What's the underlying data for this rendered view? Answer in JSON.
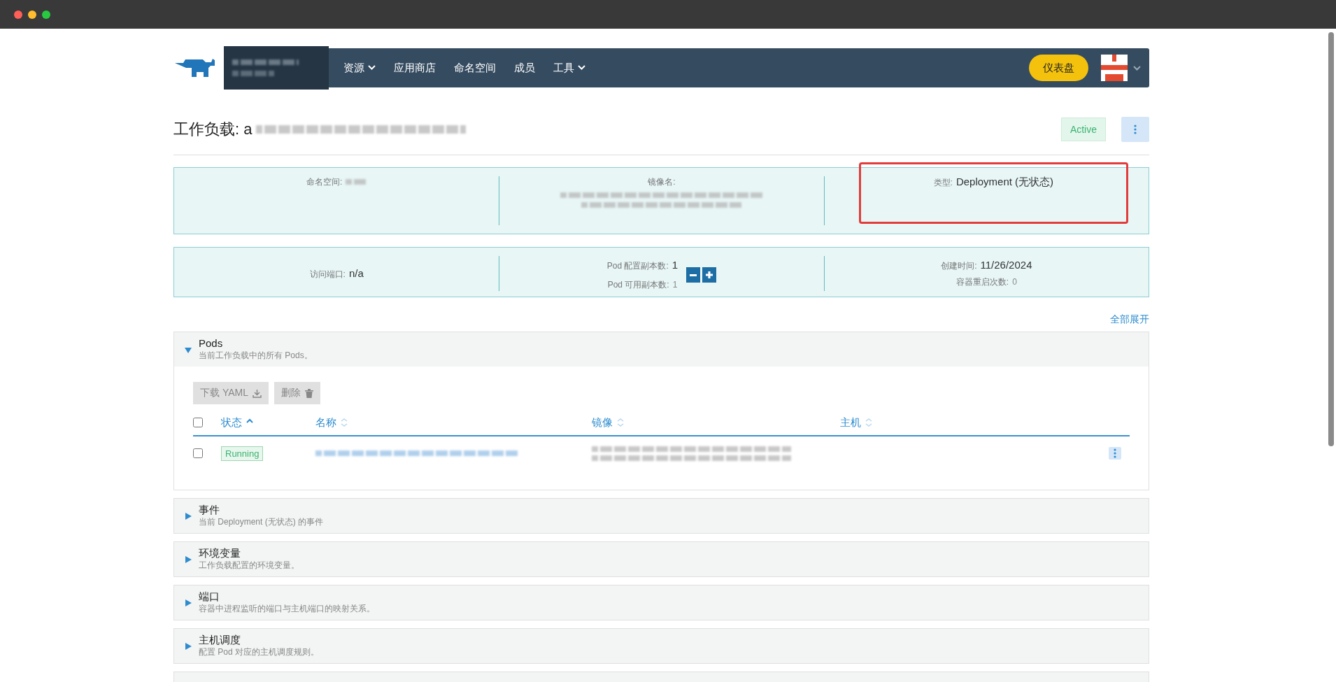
{
  "nav": {
    "items": [
      {
        "label": "资源",
        "dropdown": true
      },
      {
        "label": "应用商店",
        "dropdown": false
      },
      {
        "label": "命名空间",
        "dropdown": false
      },
      {
        "label": "成员",
        "dropdown": false
      },
      {
        "label": "工具",
        "dropdown": true
      }
    ],
    "dashboard_button": "仪表盘"
  },
  "header": {
    "title": "工作负载: a",
    "status": "Active"
  },
  "info_cards": [
    {
      "cells": [
        {
          "kind": "text",
          "highlighted": false,
          "lines": [
            {
              "label": "命名空间:",
              "kind": "redacted"
            }
          ]
        },
        {
          "kind": "text",
          "highlighted": false,
          "lines": [
            {
              "label": "镜像名:",
              "kind": "redacted-block"
            }
          ]
        },
        {
          "kind": "text",
          "highlighted": true,
          "lines": [
            {
              "label": "类型:",
              "value": "Deployment (无状态)",
              "kind": "text"
            }
          ]
        }
      ]
    },
    {
      "cells": [
        {
          "kind": "text",
          "highlighted": false,
          "lines": [
            {
              "label": "访问端口:",
              "value": "n/a",
              "kind": "text"
            }
          ]
        },
        {
          "kind": "scale",
          "highlighted": false,
          "lines": [
            {
              "label": "Pod 配置副本数:",
              "value": "1",
              "kind": "text"
            },
            {
              "label": "Pod 可用副本数:",
              "value": "1",
              "kind": "small"
            }
          ]
        },
        {
          "kind": "text",
          "highlighted": false,
          "lines": [
            {
              "label": "创建时间:",
              "value": "11/26/2024",
              "kind": "text"
            },
            {
              "label": "容器重启次数:",
              "value": "0",
              "kind": "small"
            }
          ]
        }
      ]
    }
  ],
  "expand_all": "全部展开",
  "sections": [
    {
      "title": "Pods",
      "subtitle": "当前工作负载中的所有 Pods。",
      "expanded": true,
      "toolbar": [
        {
          "label": "下载 YAML",
          "kind": "download"
        },
        {
          "label": "删除",
          "kind": "delete"
        }
      ],
      "select_all_checked": false,
      "columns": [
        {
          "label": "状态",
          "sorted": true
        },
        {
          "label": "名称",
          "sorted": false
        },
        {
          "label": "镜像",
          "sorted": false
        },
        {
          "label": "主机",
          "sorted": false
        }
      ],
      "rows": [
        {
          "checked": false,
          "status": "Running"
        }
      ]
    },
    {
      "title": "事件",
      "subtitle": "当前 Deployment (无状态) 的事件",
      "expanded": false
    },
    {
      "title": "环境变量",
      "subtitle": "工作负载配置的环境变量。",
      "expanded": false
    },
    {
      "title": "端口",
      "subtitle": "容器中进程监听的端口与主机端口的映射关系。",
      "expanded": false
    },
    {
      "title": "主机调度",
      "subtitle": "配置 Pod 对应的主机调度规则。",
      "expanded": false
    }
  ]
}
